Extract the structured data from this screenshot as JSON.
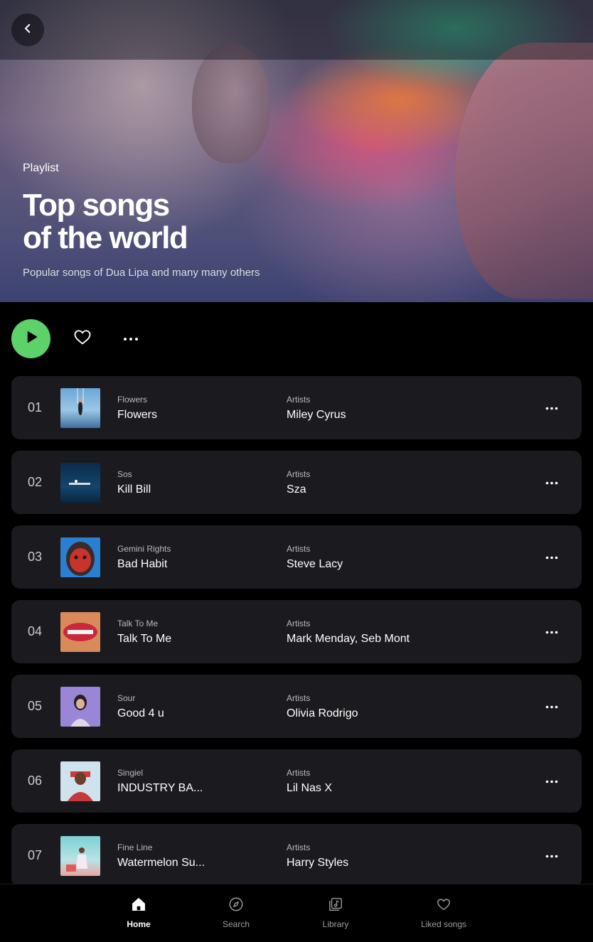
{
  "hero": {
    "label": "Playlist",
    "title_line1": "Top songs",
    "title_line2": "of the world",
    "subtitle": "Popular songs of Dua Lipa and many many others"
  },
  "icons": {
    "back": "chevron-left-icon",
    "play": "play-icon",
    "heart": "heart-outline-icon",
    "more": "more-horizontal-icon"
  },
  "colors": {
    "accent": "#5ed26a",
    "row_bg": "#1b1b1f",
    "background": "#000000"
  },
  "tracks": [
    {
      "num": "01",
      "album": "Flowers",
      "title": "Flowers",
      "artists_label": "Artists",
      "artists": "Miley Cyrus"
    },
    {
      "num": "02",
      "album": "Sos",
      "title": "Kill Bill",
      "artists_label": "Artists",
      "artists": "Sza"
    },
    {
      "num": "03",
      "album": "Gemini Rights",
      "title": "Bad Habit",
      "artists_label": "Artists",
      "artists": "Steve Lacy"
    },
    {
      "num": "04",
      "album": "Talk To Me",
      "title": "Talk To Me",
      "artists_label": "Artists",
      "artists": "Mark Menday, Seb Mont"
    },
    {
      "num": "05",
      "album": "Sour",
      "title": "Good 4 u",
      "artists_label": "Artists",
      "artists": "Olivia Rodrigo"
    },
    {
      "num": "06",
      "album": "Singiel",
      "title": "INDUSTRY BA...",
      "artists_label": "Artists",
      "artists": "Lil Nas X"
    },
    {
      "num": "07",
      "album": "Fine Line",
      "title": "Watermelon Su...",
      "artists_label": "Artists",
      "artists": "Harry Styles"
    }
  ],
  "nav": [
    {
      "label": "Home",
      "icon": "home-icon",
      "active": true
    },
    {
      "label": "Search",
      "icon": "compass-icon",
      "active": false
    },
    {
      "label": "Library",
      "icon": "library-icon",
      "active": false
    },
    {
      "label": "Liked songs",
      "icon": "heart-icon",
      "active": false
    }
  ]
}
